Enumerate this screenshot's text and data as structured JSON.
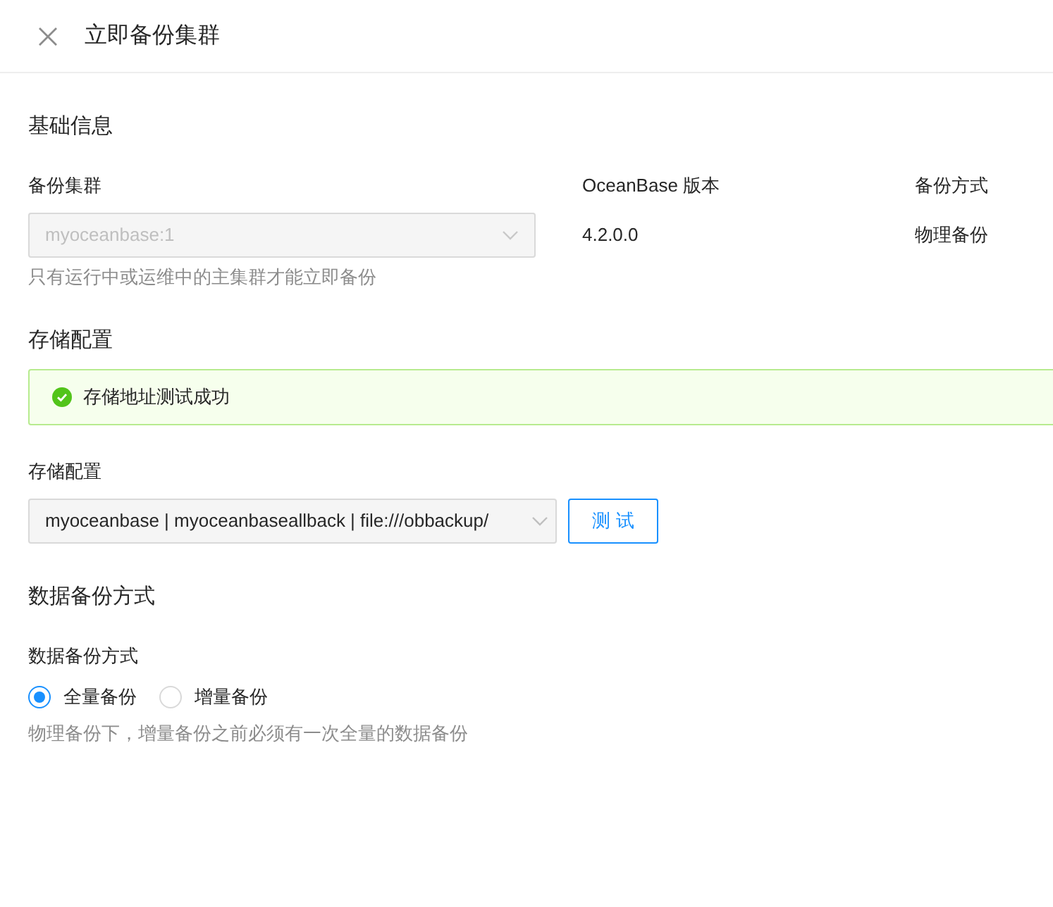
{
  "header": {
    "title": "立即备份集群"
  },
  "basic_info": {
    "heading": "基础信息",
    "fields": [
      {
        "label": "备份集群",
        "kind": "select",
        "value": "myoceanbase:1",
        "disabled": true
      },
      {
        "label": "OceanBase 版本",
        "kind": "text",
        "value": "4.2.0.0"
      },
      {
        "label": "备份方式",
        "kind": "text",
        "value": "物理备份"
      }
    ],
    "hint": "只有运行中或运维中的主集群才能立即备份"
  },
  "storage": {
    "heading": "存储配置",
    "alert": "存储地址测试成功",
    "label": "存储配置",
    "select_value": "myoceanbase | myoceanbaseallback | file:///obbackup/",
    "button": "测 试"
  },
  "data_backup": {
    "heading": "数据备份方式",
    "label": "数据备份方式",
    "options": [
      {
        "label": "全量备份",
        "selected": true
      },
      {
        "label": "增量备份",
        "selected": false
      }
    ],
    "hint": "物理备份下，增量备份之前必须有一次全量的数据备份"
  }
}
